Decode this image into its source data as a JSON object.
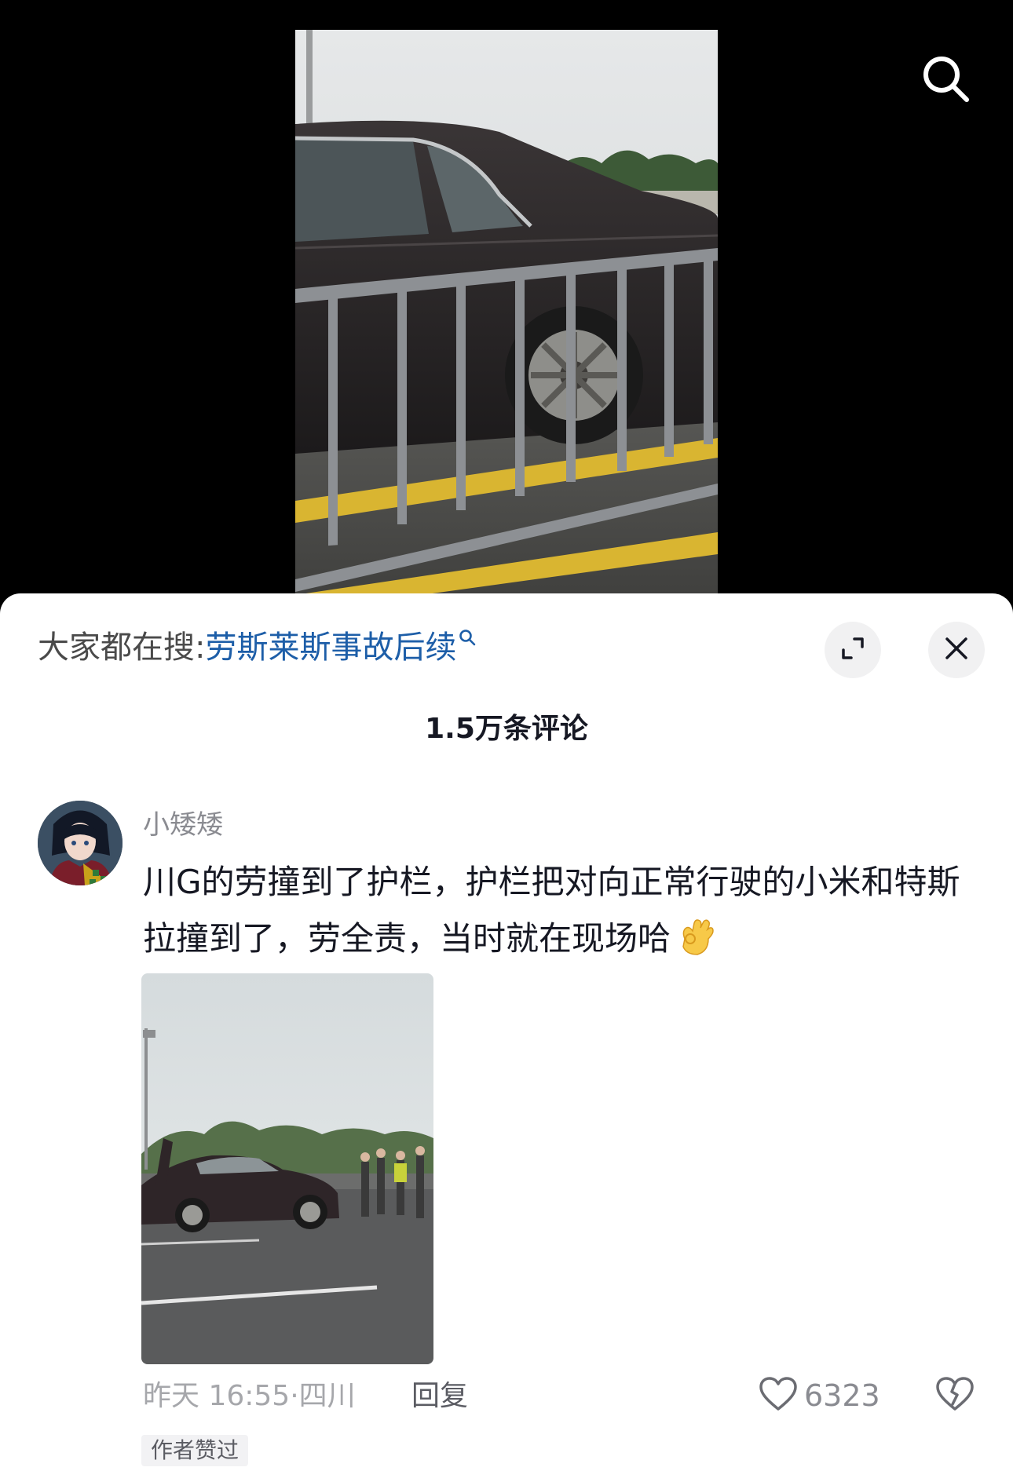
{
  "video": {
    "search_icon": "search-icon"
  },
  "sheet": {
    "hot_search": {
      "prefix": "大家都在搜:",
      "query": "劳斯莱斯事故后续",
      "query_icon": "search-small-icon"
    },
    "expand_icon": "expand-icon",
    "close_icon": "close-icon",
    "comment_count": "1.5万条评论"
  },
  "comment": {
    "username": "小矮矮",
    "text": "川G的劳撞到了护栏，护栏把对向正常行驶的小米和特斯拉撞到了，劳全责，当时就在现场哈",
    "emoji": "ok-hand-emoji",
    "timestamp": "昨天 16:55",
    "location": "四川",
    "separator": "·",
    "reply_label": "回复",
    "like_count": "6323",
    "like_icon": "heart-outline-icon",
    "dislike_icon": "broken-heart-icon",
    "author_liked": "作者赞过"
  },
  "colors": {
    "link_blue": "#1d5ea8",
    "text_primary": "#161823",
    "text_secondary": "#8a8b91"
  }
}
